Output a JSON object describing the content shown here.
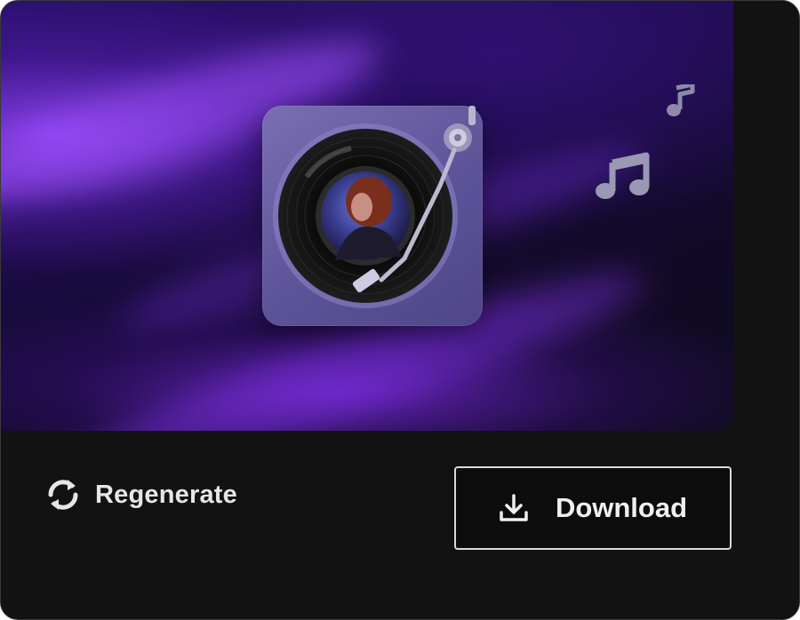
{
  "card": {
    "hero": {
      "image_alt": "Vinyl turntable with portrait album art",
      "icons": [
        "vinyl-record-icon",
        "music-note-small-icon",
        "music-notes-icon"
      ]
    },
    "actions": {
      "regenerate": {
        "label": "Regenerate",
        "icon": "refresh-icon"
      },
      "download": {
        "label": "Download",
        "icon": "download-icon"
      }
    }
  },
  "colors": {
    "card_bg": "#121212",
    "hero_purple": "#6b2ed8",
    "deck": "#6a5fa8",
    "button_border": "#d9d9d9",
    "text": "#e6e6e6"
  }
}
